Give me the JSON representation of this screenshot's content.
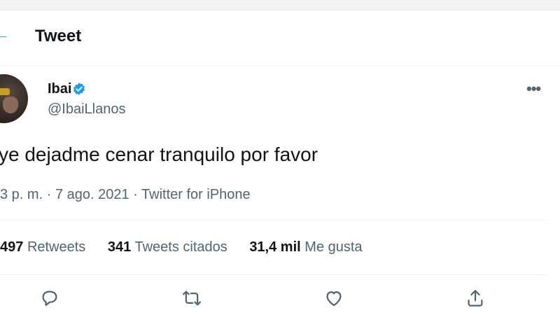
{
  "header": {
    "title": "Tweet"
  },
  "tweet": {
    "display_name": "Ibai",
    "handle": "@IbaiLlanos",
    "text": "ye dejadme cenar tranquilo por favor",
    "time": "3 p. m.",
    "separator": "·",
    "date": "7 ago. 2021",
    "source": "Twitter for iPhone"
  },
  "stats": {
    "retweets": {
      "count": "497",
      "label": "Retweets"
    },
    "quotes": {
      "count": "341",
      "label": "Tweets citados"
    },
    "likes": {
      "count": "31,4 mil",
      "label": "Me gusta"
    }
  },
  "icons": {
    "back": "back-arrow-icon",
    "verified": "verified-badge-icon",
    "more": "more-icon",
    "reply": "reply-icon",
    "retweet": "retweet-icon",
    "like": "heart-icon",
    "share": "share-icon"
  },
  "colors": {
    "accent": "#1d9bf0",
    "text": "#0f1419",
    "secondary": "#536471"
  }
}
